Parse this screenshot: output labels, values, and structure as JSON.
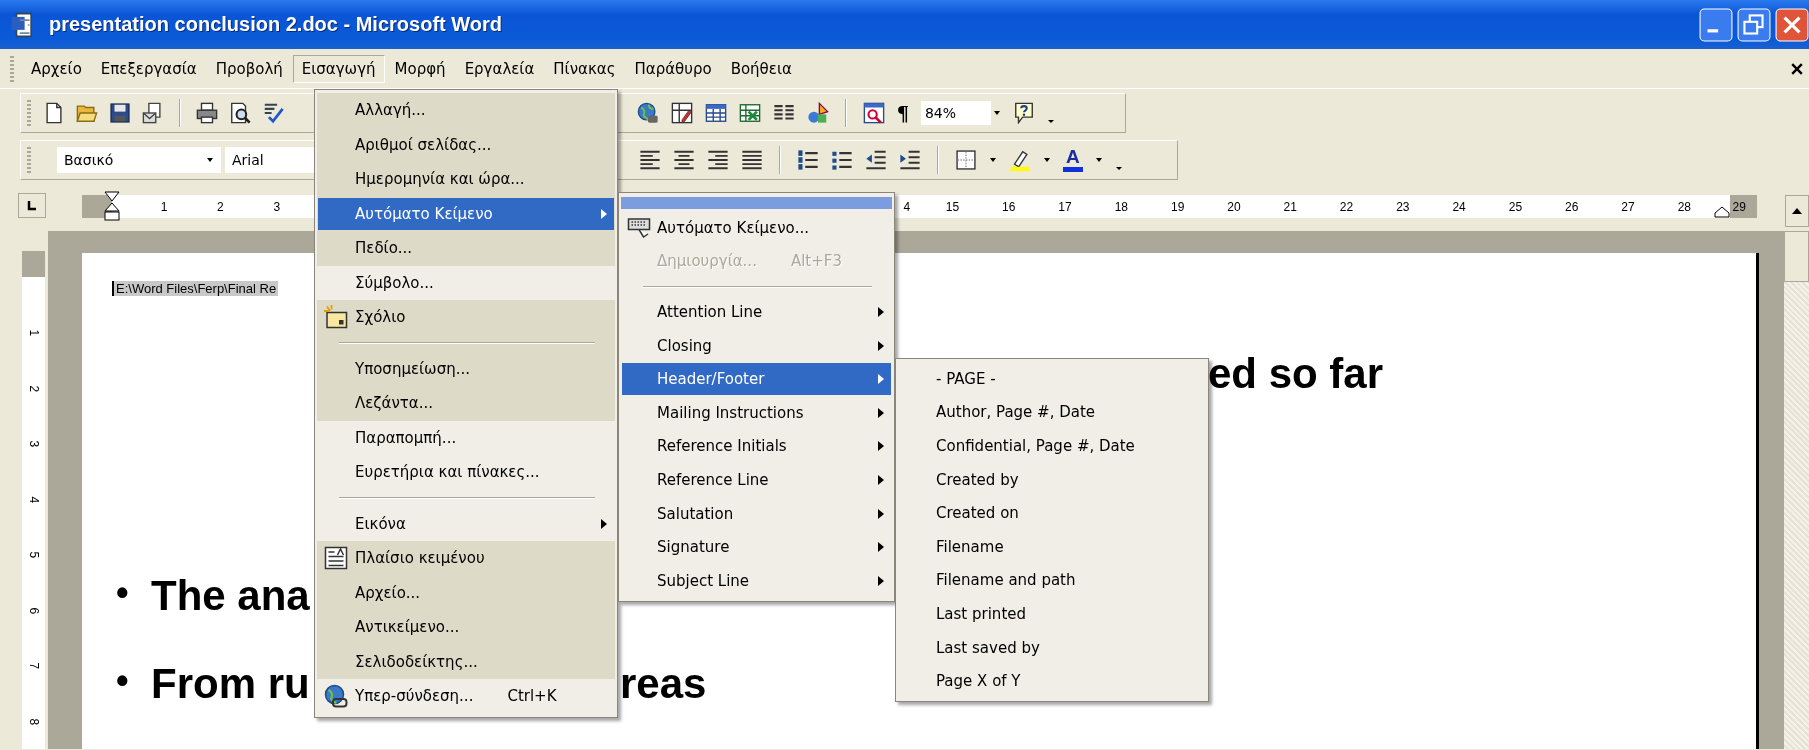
{
  "window": {
    "title": "presentation conclusion 2.doc - Microsoft Word"
  },
  "menu_bar": {
    "items": [
      {
        "label": "Αρχείο",
        "selected": false
      },
      {
        "label": "Επεξεργασία",
        "selected": false
      },
      {
        "label": "Προβολή",
        "selected": false
      },
      {
        "label": "Εισαγωγή",
        "selected": true
      },
      {
        "label": "Μορφή",
        "selected": false
      },
      {
        "label": "Εργαλεία",
        "selected": false
      },
      {
        "label": "Πίνακας",
        "selected": false
      },
      {
        "label": "Παράθυρο",
        "selected": false
      },
      {
        "label": "Βοήθεια",
        "selected": false
      }
    ]
  },
  "standard_toolbar": {
    "formatting_marks": "¶",
    "zoom": "84%"
  },
  "formatting_toolbar": {
    "style": "Βασικό",
    "font": "Arial",
    "font_color": "A"
  },
  "ruler": {
    "left_numbers": [
      "1",
      "2",
      "3"
    ],
    "right_numbers": [
      "4",
      "15",
      "16",
      "17",
      "18",
      "19",
      "20",
      "21",
      "22",
      "23",
      "24",
      "25",
      "26",
      "27",
      "28",
      "29"
    ]
  },
  "vertical_ruler": {
    "numbers": [
      "1",
      "2",
      "3",
      "4",
      "5",
      "6",
      "7",
      "8"
    ]
  },
  "document": {
    "header_path": "E:\\Word Files\\Ferp\\Final Re",
    "heading_fragment": "ed so far",
    "bullets": [
      {
        "marker": "•",
        "text": "The ana"
      },
      {
        "marker": "•",
        "text": "From ru",
        "tail": "reas"
      }
    ]
  },
  "insert_menu": {
    "items": [
      {
        "kind": "item",
        "label": "Αλλαγή...",
        "selected": false,
        "shaded": true
      },
      {
        "kind": "item",
        "label": "Αριθμοί σελίδας...",
        "selected": false,
        "shaded": true
      },
      {
        "kind": "item",
        "label": "Ημερομηνία και ώρα...",
        "selected": false,
        "shaded": true
      },
      {
        "kind": "item",
        "label": "Αυτόματο Κείμενο",
        "selected": true,
        "shaded": true,
        "submenu": true
      },
      {
        "kind": "item",
        "label": "Πεδίο...",
        "selected": false,
        "shaded": true
      },
      {
        "kind": "item",
        "label": "Σύμβολο...",
        "selected": false,
        "shaded": false
      },
      {
        "kind": "item",
        "label": "Σχόλιο",
        "selected": false,
        "shaded": true,
        "icon": true
      },
      {
        "kind": "separator",
        "shaded": true
      },
      {
        "kind": "item",
        "label": "Υποσημείωση...",
        "selected": false,
        "shaded": true
      },
      {
        "kind": "item",
        "label": "Λεζάντα...",
        "selected": false,
        "shaded": true
      },
      {
        "kind": "item",
        "label": "Παραπομπή...",
        "selected": false,
        "shaded": false
      },
      {
        "kind": "item",
        "label": "Ευρετήρια και πίνακες...",
        "selected": false,
        "shaded": false
      },
      {
        "kind": "separator",
        "shaded": false
      },
      {
        "kind": "item",
        "label": "Εικόνα",
        "selected": false,
        "shaded": false,
        "submenu": true
      },
      {
        "kind": "item",
        "label": "Πλαίσιο κειμένου",
        "selected": false,
        "shaded": true,
        "icon": true
      },
      {
        "kind": "item",
        "label": "Αρχείο...",
        "selected": false,
        "shaded": true
      },
      {
        "kind": "item",
        "label": "Αντικείμενο...",
        "selected": false,
        "shaded": true
      },
      {
        "kind": "item",
        "label": "Σελιδοδείκτης...",
        "selected": false,
        "shaded": true
      },
      {
        "kind": "item",
        "label": "Υπερ-σύνδεση...",
        "selected": false,
        "shaded": false,
        "icon": true,
        "shortcut": "Ctrl+K"
      }
    ]
  },
  "autotext_menu": {
    "tear_off_bar": true,
    "items": [
      {
        "kind": "item",
        "label": "Αυτόματο Κείμενο...",
        "selected": false,
        "icon": true
      },
      {
        "kind": "item",
        "label": "Δημιουργία...",
        "selected": false,
        "disabled": true,
        "shortcut": "Alt+F3"
      },
      {
        "kind": "separator"
      },
      {
        "kind": "item",
        "label": "Attention Line",
        "selected": false,
        "submenu": true
      },
      {
        "kind": "item",
        "label": "Closing",
        "selected": false,
        "submenu": true
      },
      {
        "kind": "item",
        "label": "Header/Footer",
        "selected": true,
        "submenu": true
      },
      {
        "kind": "item",
        "label": "Mailing Instructions",
        "selected": false,
        "submenu": true
      },
      {
        "kind": "item",
        "label": "Reference Initials",
        "selected": false,
        "submenu": true
      },
      {
        "kind": "item",
        "label": "Reference Line",
        "selected": false,
        "submenu": true
      },
      {
        "kind": "item",
        "label": "Salutation",
        "selected": false,
        "submenu": true
      },
      {
        "kind": "item",
        "label": "Signature",
        "selected": false,
        "submenu": true
      },
      {
        "kind": "item",
        "label": "Subject Line",
        "selected": false,
        "submenu": true
      }
    ]
  },
  "header_footer_menu": {
    "items": [
      {
        "kind": "item",
        "label": "- PAGE -",
        "selected": false
      },
      {
        "kind": "item",
        "label": "Author, Page #, Date",
        "selected": false
      },
      {
        "kind": "item",
        "label": "Confidential, Page #, Date",
        "selected": false
      },
      {
        "kind": "item",
        "label": "Created by",
        "selected": false
      },
      {
        "kind": "item",
        "label": "Created on",
        "selected": false
      },
      {
        "kind": "item",
        "label": "Filename",
        "selected": false
      },
      {
        "kind": "item",
        "label": "Filename and path",
        "selected": false
      },
      {
        "kind": "item",
        "label": "Last printed",
        "selected": false
      },
      {
        "kind": "item",
        "label": "Last saved by",
        "selected": false
      },
      {
        "kind": "item",
        "label": "Page X of Y",
        "selected": false
      }
    ]
  }
}
